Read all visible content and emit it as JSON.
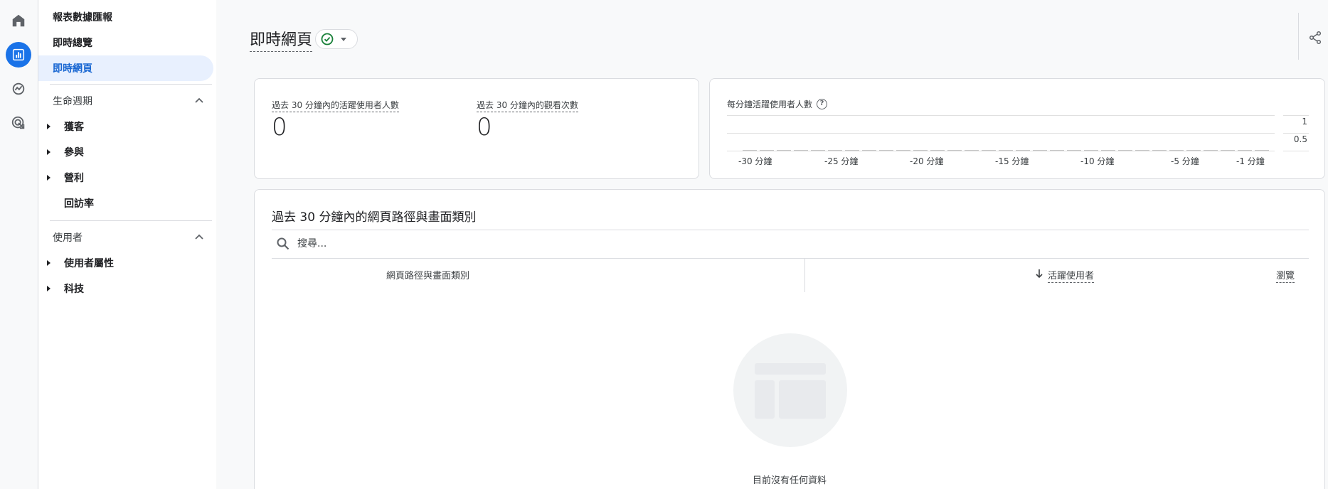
{
  "rail": {
    "items": [
      {
        "icon": "home-icon"
      },
      {
        "icon": "reports-icon",
        "active": true
      },
      {
        "icon": "explore-icon"
      },
      {
        "icon": "advertising-icon"
      }
    ]
  },
  "nav": {
    "items": [
      {
        "label": "報表數據匯報"
      },
      {
        "label": "即時總覽"
      },
      {
        "label": "即時網頁",
        "selected": true
      }
    ],
    "lifecycle": {
      "label": "生命週期",
      "items": [
        {
          "label": "獲客"
        },
        {
          "label": "參與"
        },
        {
          "label": "營利"
        },
        {
          "label": "回訪率"
        }
      ]
    },
    "user": {
      "label": "使用者",
      "items": [
        {
          "label": "使用者屬性"
        },
        {
          "label": "科技"
        }
      ]
    }
  },
  "header": {
    "title": "即時網頁"
  },
  "metrics": {
    "active_users_label": "過去 30 分鐘內的活躍使用者人數",
    "active_users_value": "0",
    "views_label": "過去 30 分鐘內的觀看次數",
    "views_value": "0"
  },
  "minute_chart": {
    "title": "每分鐘活躍使用者人數",
    "help_glyph": "?",
    "y_ticks": [
      "1",
      "0.5"
    ],
    "x_ticks": [
      "-30 分鐘",
      "-25 分鐘",
      "-20 分鐘",
      "-15 分鐘",
      "-10 分鐘",
      "-5 分鐘",
      "-1 分鐘"
    ]
  },
  "table": {
    "title": "過去 30 分鐘內的網頁路徑與畫面類別",
    "search_placeholder": "搜尋...",
    "col_path": "網頁路徑與畫面類別",
    "col_active": "活躍使用者",
    "col_views": "瀏覽",
    "empty_message": "目前沒有任何資料"
  },
  "colors": {
    "accent": "#1a73e8",
    "selected_bg": "#e8f0fe",
    "status_ok": "#188038"
  }
}
